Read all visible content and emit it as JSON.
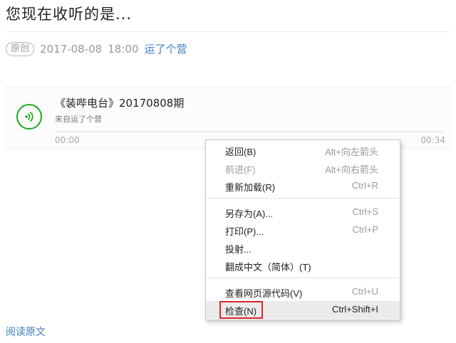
{
  "article": {
    "title": "您现在收听的是...",
    "original_tag": "原创",
    "date": "2017-08-08",
    "time": "18:00",
    "account": "运了个营"
  },
  "audio": {
    "title": "《装哔电台》20170808期",
    "source": "来自运了个营",
    "current_time": "00:00",
    "duration": "00:34",
    "progress": 0
  },
  "context_menu": {
    "items": [
      {
        "label": "返回(B)",
        "shortcut": "Alt+向左箭头",
        "disabled": false
      },
      {
        "label": "前进(F)",
        "shortcut": "Alt+向右箭头",
        "disabled": true
      },
      {
        "label": "重新加载(R)",
        "shortcut": "Ctrl+R",
        "disabled": false
      },
      {
        "label": "另存为(A)...",
        "shortcut": "Ctrl+S",
        "disabled": false
      },
      {
        "label": "打印(P)...",
        "shortcut": "Ctrl+P",
        "disabled": false
      },
      {
        "label": "投射...",
        "shortcut": "",
        "disabled": false
      },
      {
        "label": "翻成中文（简体）(T)",
        "shortcut": "",
        "disabled": false
      },
      {
        "label": "查看网页源代码(V)",
        "shortcut": "Ctrl+U",
        "disabled": false
      },
      {
        "label": "检查(N)",
        "shortcut": "Ctrl+Shift+I",
        "disabled": false,
        "highlighted": true
      }
    ]
  },
  "footer": {
    "read_original": "阅读原文"
  },
  "colors": {
    "accent_green": "#1aad19",
    "link_blue": "#3b7dc1",
    "annotation_red": "#d8262a"
  }
}
